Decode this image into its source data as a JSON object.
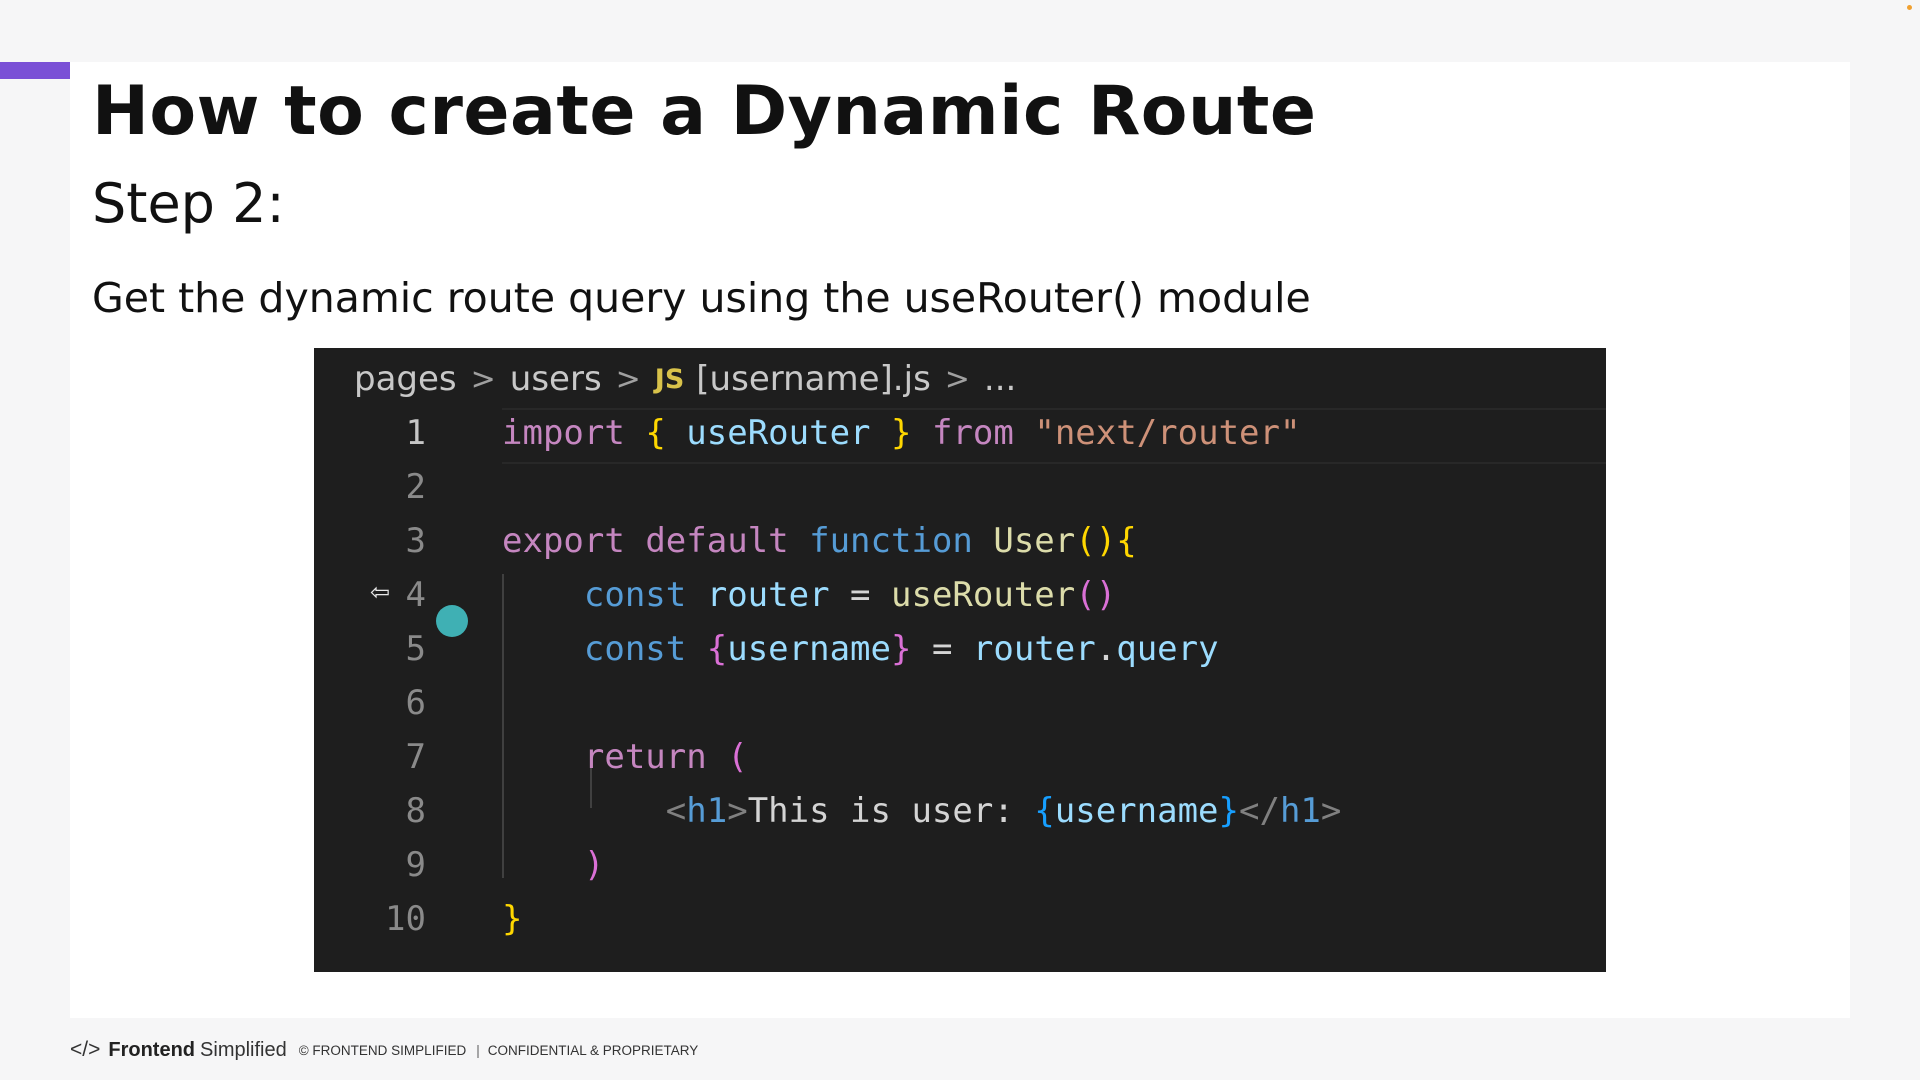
{
  "slide": {
    "title": "How to create a Dynamic Route",
    "step": "Step 2:",
    "description": "Get the dynamic route query using the useRouter() module"
  },
  "editor": {
    "breadcrumb": {
      "segments": [
        "pages",
        "users"
      ],
      "file_icon": "JS",
      "file": "[username].js",
      "ellipsis": "..."
    },
    "line_numbers": [
      "1",
      "2",
      "3",
      "4",
      "5",
      "6",
      "7",
      "8",
      "9",
      "10"
    ],
    "code": {
      "l1": {
        "import": "import",
        "ob": "{",
        "name": "useRouter",
        "cb": "}",
        "from": "from",
        "str": "\"next/router\""
      },
      "l3": {
        "export": "export",
        "default": "default",
        "function": "function",
        "fname": "User",
        "paren": "()",
        "brace": "{"
      },
      "l4": {
        "const": "const",
        "var": "router",
        "eq": "=",
        "call": "useRouter",
        "paren": "()"
      },
      "l5": {
        "const": "const",
        "ob": "{",
        "var": "username",
        "cb": "}",
        "eq": "=",
        "obj": "router",
        "dot": ".",
        "prop": "query"
      },
      "l7": {
        "return": "return",
        "paren": "("
      },
      "l8": {
        "open_lt": "<",
        "open_tag": "h1",
        "open_gt": ">",
        "text": "This is user: ",
        "ob": "{",
        "var": "username",
        "cb": "}",
        "close_lt": "</",
        "close_tag": "h1",
        "close_gt": ">"
      },
      "l9": {
        "paren": ")"
      },
      "l10": {
        "brace": "}"
      }
    },
    "cursor_icon": "drag-arrow-icon",
    "pointer_color": "#3fb0b4"
  },
  "footer": {
    "logo_glyph": "</>",
    "brand_bold": "Frontend",
    "brand_light": "Simplified",
    "copyright": "© FRONTEND SIMPLIFIED",
    "divider": "|",
    "notice": "CONFIDENTIAL & PROPRIETARY"
  },
  "colors": {
    "accent": "#7a4fd6",
    "editor_bg": "#1e1e1e",
    "keyword": "#c586c0",
    "storage": "#569cd6",
    "variable": "#9cdcfe",
    "function": "#dcdcaa",
    "string": "#ce9178",
    "bracket_gold": "#ffd700"
  }
}
